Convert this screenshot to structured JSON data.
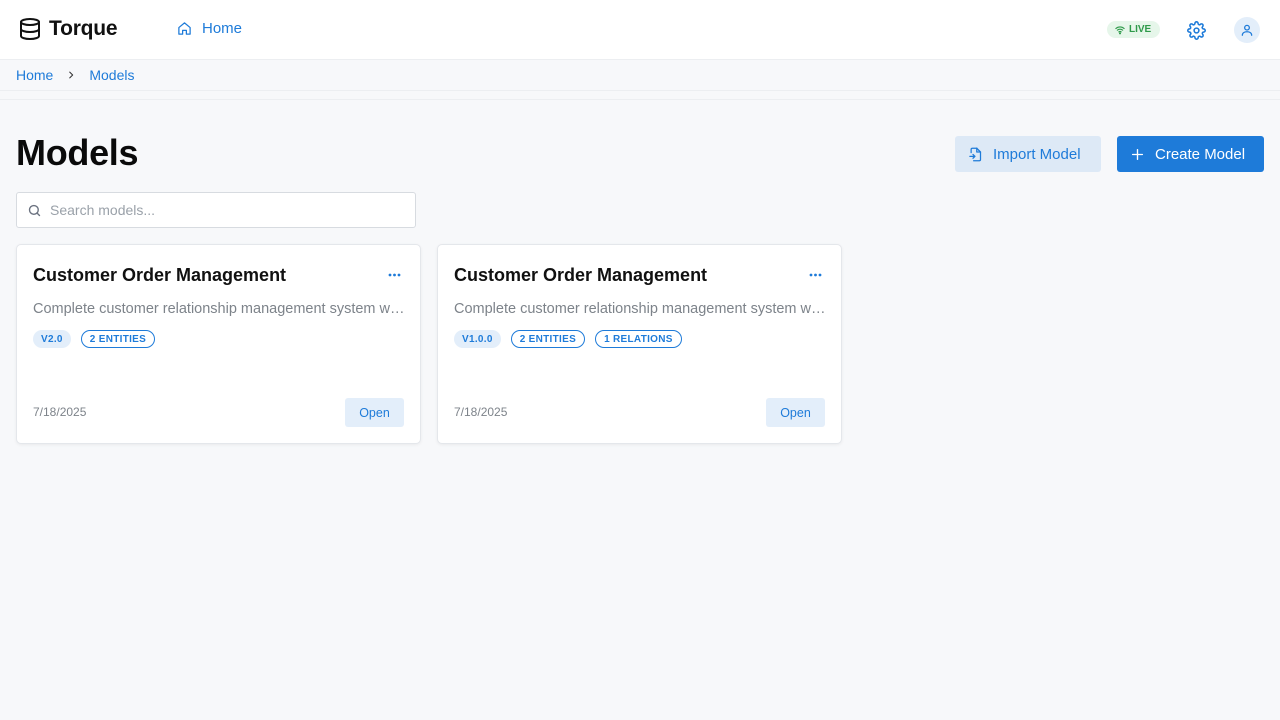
{
  "header": {
    "app_name": "Torque",
    "nav_home": "Home",
    "live_label": "LIVE"
  },
  "breadcrumb": {
    "items": [
      {
        "label": "Home"
      },
      {
        "label": "Models"
      }
    ]
  },
  "page": {
    "title": "Models",
    "import_label": "Import Model",
    "create_label": "Create Model"
  },
  "search": {
    "placeholder": "Search models...",
    "value": ""
  },
  "cards": [
    {
      "title": "Customer Order Management",
      "description": "Complete customer relationship management system with orders, products and invoices",
      "tags": [
        "V2.0",
        "2 ENTITIES"
      ],
      "date": "7/18/2025",
      "open_label": "Open"
    },
    {
      "title": "Customer Order Management",
      "description": "Complete customer relationship management system with orders, products and invoices",
      "tags": [
        "V1.0.0",
        "2 ENTITIES",
        "1 RELATIONS"
      ],
      "date": "7/18/2025",
      "open_label": "Open"
    }
  ],
  "colors": {
    "accent": "#1e7bd9",
    "live_green": "#2e9a4a",
    "background": "#f7f8fa"
  },
  "icons": [
    "database-icon",
    "home-icon",
    "wifi-icon",
    "gear-icon",
    "user-icon",
    "chevron-right-icon",
    "file-import-icon",
    "plus-icon",
    "search-icon",
    "more-horizontal-icon"
  ]
}
